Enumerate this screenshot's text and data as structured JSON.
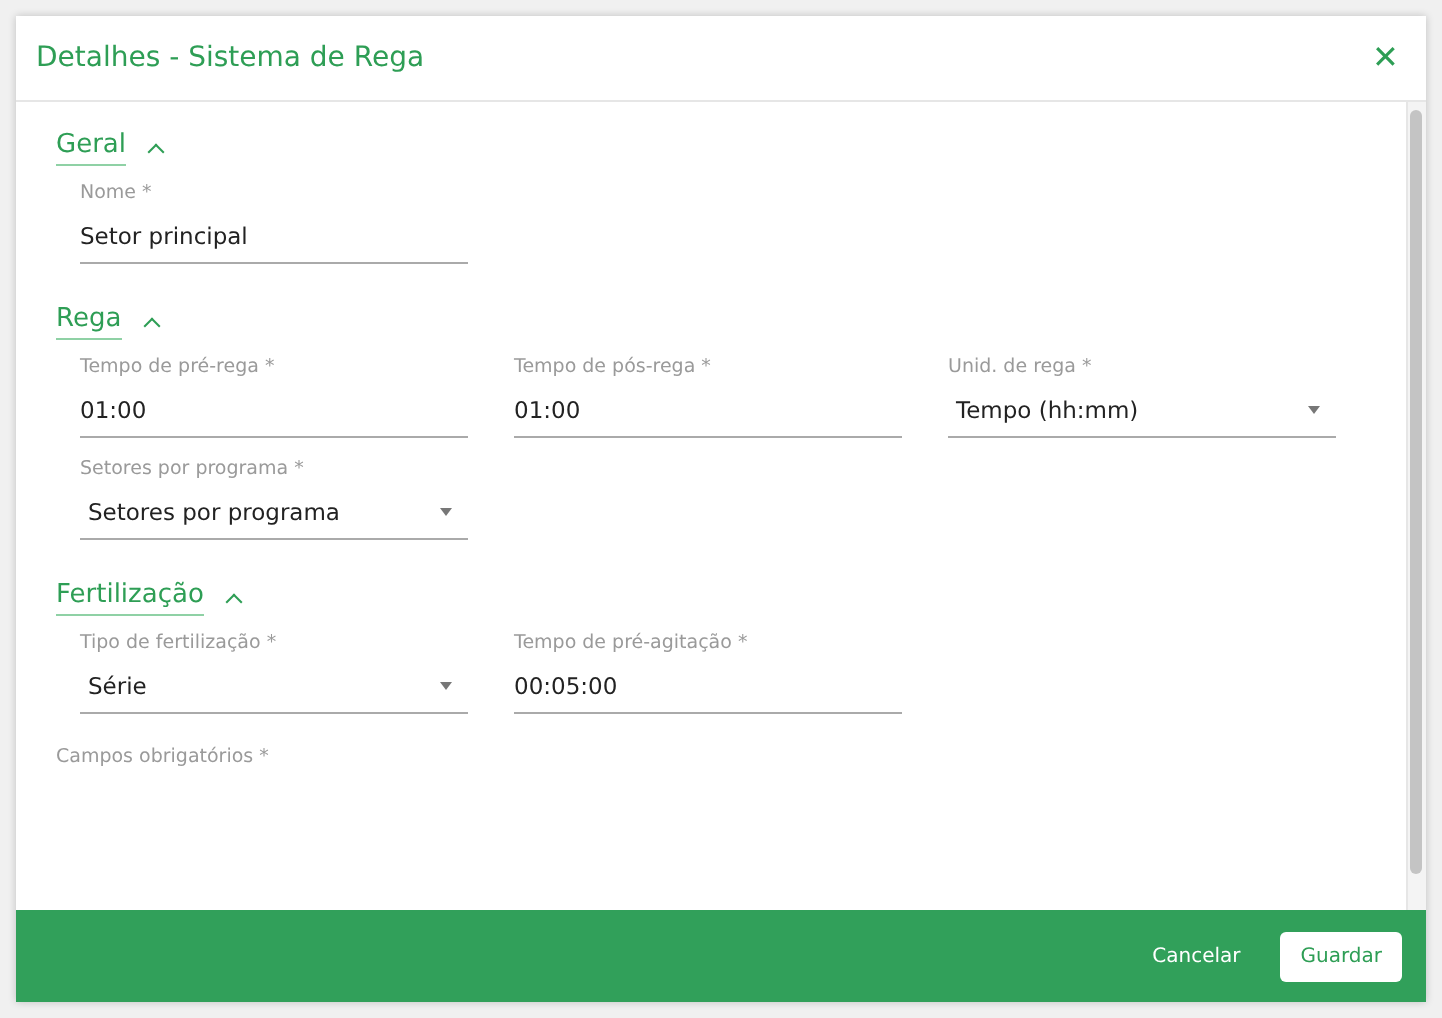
{
  "dialog": {
    "title": "Detalhes - Sistema de Rega",
    "close": "✕"
  },
  "sections": [
    {
      "title": "Geral",
      "expanded": true,
      "rows": [
        [
          {
            "kind": "text",
            "label": "Nome *",
            "value": "Setor principal"
          }
        ]
      ]
    },
    {
      "title": "Rega",
      "expanded": true,
      "rows": [
        [
          {
            "kind": "text",
            "label": "Tempo de pré-rega *",
            "value": "01:00"
          },
          {
            "kind": "text",
            "label": "Tempo de pós-rega *",
            "value": "01:00"
          },
          {
            "kind": "select",
            "label": "Unid. de rega *",
            "value": "Tempo (hh:mm)"
          }
        ],
        [
          {
            "kind": "select",
            "label": "Setores por programa *",
            "value": "Setores por programa"
          }
        ]
      ]
    },
    {
      "title": "Fertilização",
      "expanded": true,
      "rows": [
        [
          {
            "kind": "select",
            "label": "Tipo de fertilização *",
            "value": "Série"
          },
          {
            "kind": "text",
            "label": "Tempo de pré-agitação *",
            "value": "00:05:00"
          }
        ]
      ]
    }
  ],
  "note": "Campos obrigatórios *",
  "buttons": [
    {
      "kind": "flat",
      "label": "Cancelar"
    },
    {
      "kind": "raised",
      "label": "Guardar"
    }
  ]
}
